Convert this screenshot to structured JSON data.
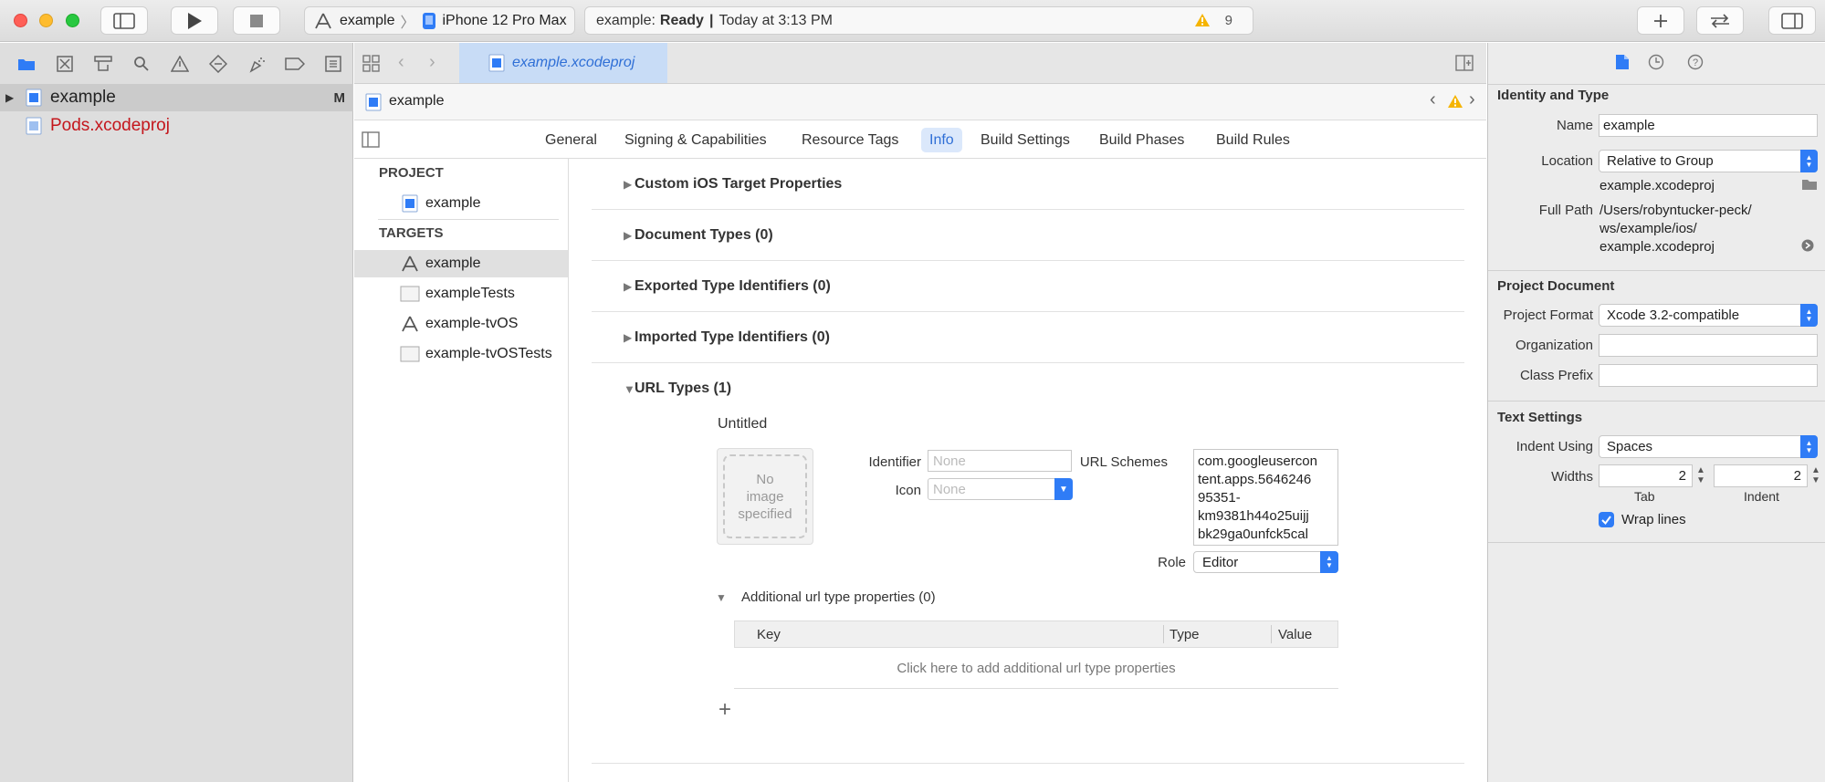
{
  "toolbar": {
    "scheme_target": "example",
    "scheme_device": "iPhone 12 Pro Max",
    "status_prefix": "example:",
    "status_state": "Ready",
    "status_sep": "|",
    "status_time": "Today at 3:13 PM",
    "warning_count": "9",
    "colors": {
      "close": "#ff5f57",
      "minimize": "#febc2e",
      "zoom": "#28c840",
      "warning": "#f5b400"
    }
  },
  "navigator": {
    "items": [
      {
        "label": "example",
        "badge": "M"
      },
      {
        "label": "Pods.xcodeproj"
      }
    ],
    "pods_color": "#c4161c"
  },
  "editor": {
    "tab_title": "example.xcodeproj",
    "jump_title": "example",
    "setting_tabs": [
      "General",
      "Signing & Capabilities",
      "Resource Tags",
      "Info",
      "Build Settings",
      "Build Phases",
      "Build Rules"
    ],
    "active_tab": "Info",
    "project_header": "PROJECT",
    "project_item": "example",
    "targets_header": "TARGETS",
    "targets": [
      "example",
      "exampleTests",
      "example-tvOS",
      "example-tvOSTests"
    ],
    "sections": [
      "Custom iOS Target Properties",
      "Document Types (0)",
      "Exported Type Identifiers (0)",
      "Imported Type Identifiers (0)",
      "URL Types (1)"
    ],
    "url_type": {
      "name": "Untitled",
      "image_placeholder_1": "No",
      "image_placeholder_2": "image",
      "image_placeholder_3": "specified",
      "identifier_label": "Identifier",
      "identifier_placeholder": "None",
      "icon_label": "Icon",
      "icon_placeholder": "None",
      "schemes_label": "URL Schemes",
      "schemes_lines": [
        "com.googleusercon",
        "tent.apps.5646246",
        "95351-",
        "km9381h44o25uijj",
        "bk29ga0unfck5cal"
      ],
      "role_label": "Role",
      "role_value": "Editor",
      "additional_label": "Additional url type properties (0)",
      "table_headers": [
        "Key",
        "Type",
        "Value"
      ],
      "table_empty": "Click here to add additional url type properties",
      "add_symbol": "+"
    }
  },
  "inspector": {
    "identity_header": "Identity and Type",
    "name_label": "Name",
    "name_value": "example",
    "location_label": "Location",
    "location_value": "Relative to Group",
    "file_name": "example.xcodeproj",
    "full_path_label": "Full Path",
    "full_path_lines": [
      "/Users/robyntucker-peck/",
      "ws/example/ios/",
      "example.xcodeproj"
    ],
    "project_doc_header": "Project Document",
    "format_label": "Project Format",
    "format_value": "Xcode 3.2-compatible",
    "org_label": "Organization",
    "prefix_label": "Class Prefix",
    "text_header": "Text Settings",
    "indent_label": "Indent Using",
    "indent_value": "Spaces",
    "widths_label": "Widths",
    "tab_value": "2",
    "indent_width_value": "2",
    "tab_caption": "Tab",
    "indent_caption": "Indent",
    "wrap_label": "Wrap lines"
  },
  "colors": {
    "accent": "#2f7cf6",
    "selection": "#d6d6d6",
    "link_blue": "#2f6fd6"
  }
}
